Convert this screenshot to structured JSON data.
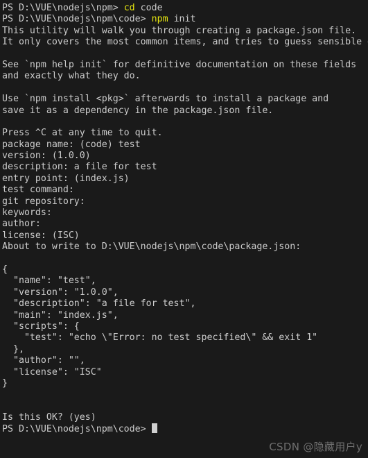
{
  "terminal": {
    "shell": "PowerShell",
    "background_color": "#1a1a1a",
    "foreground_color": "#cccccc",
    "command_color": "#e5e510",
    "cursor_color": "#d0d0d0",
    "font_size_px": 13.3,
    "line_height_px": 16.4,
    "columns": 64,
    "rows": 40
  },
  "lines": [
    {
      "id": "line-01",
      "segments": [
        {
          "text": "PS D:\\VUE\\nodejs\\npm> ",
          "style": "c-prompt"
        },
        {
          "text": "cd",
          "style": "c-cmd"
        },
        {
          "text": " code",
          "style": "c-default"
        }
      ]
    },
    {
      "id": "line-02",
      "segments": [
        {
          "text": "PS D:\\VUE\\nodejs\\npm\\code> ",
          "style": "c-prompt"
        },
        {
          "text": "npm",
          "style": "c-cmd"
        },
        {
          "text": " init",
          "style": "c-default"
        }
      ]
    },
    {
      "id": "line-03",
      "segments": [
        {
          "text": "This utility will walk you through creating a package.json file.",
          "style": "c-default"
        }
      ]
    },
    {
      "id": "line-04",
      "segments": [
        {
          "text": "It only covers the most common items, and tries to guess sensible defaults.",
          "style": "c-default"
        }
      ]
    },
    {
      "id": "line-05",
      "segments": [
        {
          "text": "",
          "style": "c-blank"
        }
      ]
    },
    {
      "id": "line-06",
      "segments": [
        {
          "text": "See `npm help init` for definitive documentation on these fields",
          "style": "c-default"
        }
      ]
    },
    {
      "id": "line-07",
      "segments": [
        {
          "text": "and exactly what they do.",
          "style": "c-default"
        }
      ]
    },
    {
      "id": "line-08",
      "segments": [
        {
          "text": "",
          "style": "c-blank"
        }
      ]
    },
    {
      "id": "line-09",
      "segments": [
        {
          "text": "Use `npm install <pkg>` afterwards to install a package and",
          "style": "c-default"
        }
      ]
    },
    {
      "id": "line-10",
      "segments": [
        {
          "text": "save it as a dependency in the package.json file.",
          "style": "c-default"
        }
      ]
    },
    {
      "id": "line-11",
      "segments": [
        {
          "text": "",
          "style": "c-blank"
        }
      ]
    },
    {
      "id": "line-12",
      "segments": [
        {
          "text": "Press ^C at any time to quit.",
          "style": "c-default"
        }
      ]
    },
    {
      "id": "line-13",
      "segments": [
        {
          "text": "package name: (code) test",
          "style": "c-default"
        }
      ]
    },
    {
      "id": "line-14",
      "segments": [
        {
          "text": "version: (1.0.0)",
          "style": "c-default"
        }
      ]
    },
    {
      "id": "line-15",
      "segments": [
        {
          "text": "description: a file for test",
          "style": "c-default"
        }
      ]
    },
    {
      "id": "line-16",
      "segments": [
        {
          "text": "entry point: (index.js)",
          "style": "c-default"
        }
      ]
    },
    {
      "id": "line-17",
      "segments": [
        {
          "text": "test command:",
          "style": "c-default"
        }
      ]
    },
    {
      "id": "line-18",
      "segments": [
        {
          "text": "git repository:",
          "style": "c-default"
        }
      ]
    },
    {
      "id": "line-19",
      "segments": [
        {
          "text": "keywords:",
          "style": "c-default"
        }
      ]
    },
    {
      "id": "line-20",
      "segments": [
        {
          "text": "author:",
          "style": "c-default"
        }
      ]
    },
    {
      "id": "line-21",
      "segments": [
        {
          "text": "license: (ISC)",
          "style": "c-default"
        }
      ]
    },
    {
      "id": "line-22",
      "segments": [
        {
          "text": "About to write to D:\\VUE\\nodejs\\npm\\code\\package.json:",
          "style": "c-default"
        }
      ]
    },
    {
      "id": "line-23",
      "segments": [
        {
          "text": "",
          "style": "c-blank"
        }
      ]
    },
    {
      "id": "line-24",
      "segments": [
        {
          "text": "{",
          "style": "c-default"
        }
      ]
    },
    {
      "id": "line-25",
      "segments": [
        {
          "text": "  \"name\": \"test\",",
          "style": "c-default"
        }
      ]
    },
    {
      "id": "line-26",
      "segments": [
        {
          "text": "  \"version\": \"1.0.0\",",
          "style": "c-default"
        }
      ]
    },
    {
      "id": "line-27",
      "segments": [
        {
          "text": "  \"description\": \"a file for test\",",
          "style": "c-default"
        }
      ]
    },
    {
      "id": "line-28",
      "segments": [
        {
          "text": "  \"main\": \"index.js\",",
          "style": "c-default"
        }
      ]
    },
    {
      "id": "line-29",
      "segments": [
        {
          "text": "  \"scripts\": {",
          "style": "c-default"
        }
      ]
    },
    {
      "id": "line-30",
      "segments": [
        {
          "text": "    \"test\": \"echo \\\"Error: no test specified\\\" && exit 1\"",
          "style": "c-default"
        }
      ]
    },
    {
      "id": "line-31",
      "segments": [
        {
          "text": "  },",
          "style": "c-default"
        }
      ]
    },
    {
      "id": "line-32",
      "segments": [
        {
          "text": "  \"author\": \"\",",
          "style": "c-default"
        }
      ]
    },
    {
      "id": "line-33",
      "segments": [
        {
          "text": "  \"license\": \"ISC\"",
          "style": "c-default"
        }
      ]
    },
    {
      "id": "line-34",
      "segments": [
        {
          "text": "}",
          "style": "c-default"
        }
      ]
    },
    {
      "id": "line-35",
      "segments": [
        {
          "text": "",
          "style": "c-blank"
        }
      ]
    },
    {
      "id": "line-36",
      "segments": [
        {
          "text": "",
          "style": "c-blank"
        }
      ]
    },
    {
      "id": "line-37",
      "segments": [
        {
          "text": "Is this OK? (yes)",
          "style": "c-default"
        }
      ]
    },
    {
      "id": "line-38",
      "segments": [
        {
          "text": "PS D:\\VUE\\nodejs\\npm\\code> ",
          "style": "c-prompt"
        },
        {
          "text": "",
          "style": "cursor"
        }
      ]
    }
  ],
  "watermark": {
    "text": "CSDN @隐藏用户y",
    "color": "#6f6f6f"
  }
}
